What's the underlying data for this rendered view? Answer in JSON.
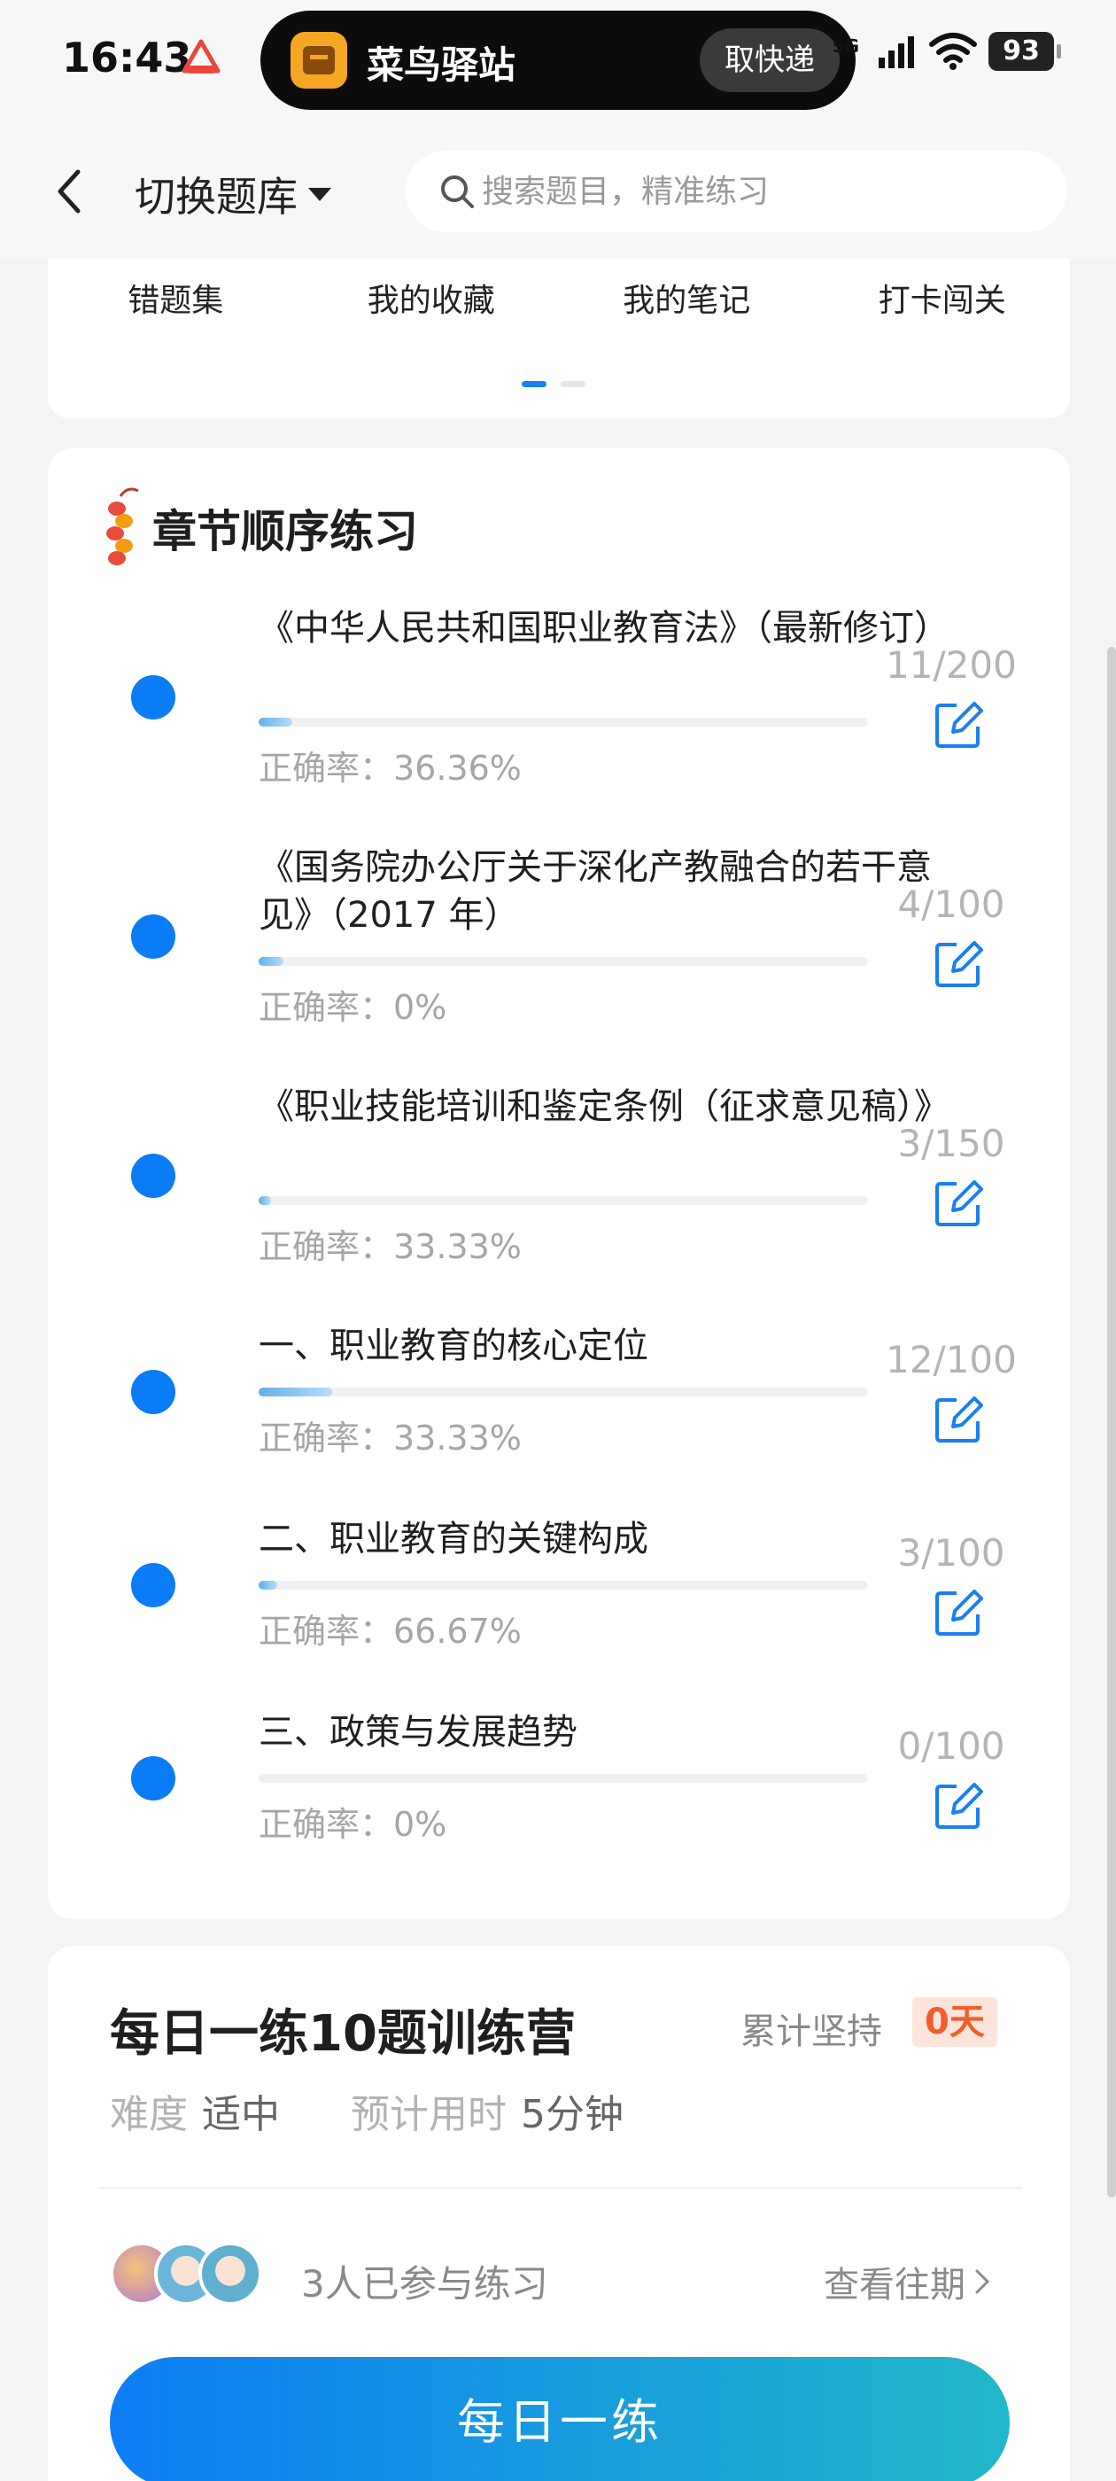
{
  "status_bar": {
    "time": "16:43",
    "island_app_name": "菜鸟驿站",
    "island_button": "取快递",
    "network": "5G",
    "battery": "93"
  },
  "header": {
    "switch_label": "切换题库",
    "search_placeholder": "搜索题目，精准练习"
  },
  "quick_links": [
    "错题集",
    "我的收藏",
    "我的笔记",
    "打卡闯关"
  ],
  "chapter_section": {
    "title": "章节顺序练习",
    "items": [
      {
        "name": "《中华人民共和国职业教育法》（最新修订）",
        "count": "11/200",
        "accuracy": "正确率：36.36%",
        "progress": 0.055
      },
      {
        "name": "《国务院办公厅关于深化产教融合的若干意见》（2017 年）",
        "count": "4/100",
        "accuracy": "正确率：0%",
        "progress": 0.04
      },
      {
        "name": "《职业技能培训和鉴定条例（征求意见稿）》",
        "count": "3/150",
        "accuracy": "正确率：33.33%",
        "progress": 0.02
      },
      {
        "name": "一、职业教育的核心定位",
        "count": "12/100",
        "accuracy": "正确率：33.33%",
        "progress": 0.12
      },
      {
        "name": "二、职业教育的关键构成",
        "count": "3/100",
        "accuracy": "正确率：66.67%",
        "progress": 0.03
      },
      {
        "name": "三、政策与发展趋势",
        "count": "0/100",
        "accuracy": "正确率：0%",
        "progress": 0
      }
    ]
  },
  "daily": {
    "title": "每日一练10题训练营",
    "streak_label": "累计坚持",
    "streak_value": "0天",
    "difficulty_key": "难度",
    "difficulty_value": "适中",
    "time_key": "预计用时",
    "time_value": "5分钟",
    "participants": "3人已参与练习",
    "history_link": "查看往期",
    "button_label": "每日一练"
  },
  "colors": {
    "accent": "#0a7cf5",
    "streak": "#f25d2a",
    "button_gradient_start": "#0d7ef5",
    "button_gradient_end": "#22b7c9"
  }
}
